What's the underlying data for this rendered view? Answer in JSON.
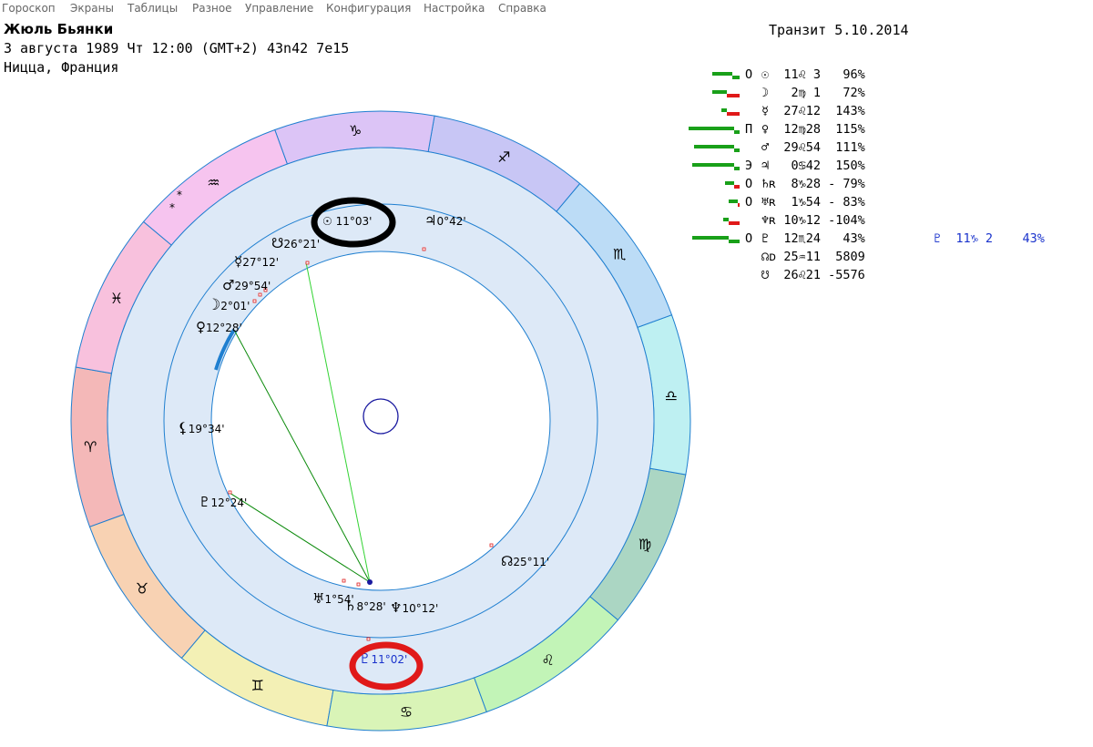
{
  "menu": [
    "Гороскоп",
    "Экраны",
    "Таблицы",
    "Разное",
    "Управление",
    "Конфигурация",
    "Настройка",
    "Справка"
  ],
  "person": {
    "name": "Жюль Бьянки",
    "birth_line": "3 августа 1989  Чт  12:00 (GMT+2) 43n42  7e15",
    "place": "Ницца, Франция"
  },
  "transit": "Транзит  5.10.2014",
  "planets": [
    {
      "mark": "O",
      "text": "☉  11♌ 3   96%",
      "bars": [
        {
          "color": "#19a019",
          "w": 22
        },
        {
          "color": "#19a019",
          "w": 8
        }
      ]
    },
    {
      "mark": "",
      "text": "☽   2♍ 1   72%",
      "bars": [
        {
          "color": "#19a019",
          "w": 16
        },
        {
          "color": "#e01919",
          "w": 14
        }
      ]
    },
    {
      "mark": "",
      "text": "☿  27♌12  143%",
      "bars": [
        {
          "color": "#19a019",
          "w": 6
        },
        {
          "color": "#e01919",
          "w": 14
        }
      ]
    },
    {
      "mark": "П",
      "text": "♀  12♍28  115%",
      "bars": [
        {
          "color": "#19a019",
          "w": 50
        },
        {
          "color": "#19a019",
          "w": 6
        }
      ]
    },
    {
      "mark": "",
      "text": "♂  29♌54  111%",
      "bars": [
        {
          "color": "#19a019",
          "w": 44
        },
        {
          "color": "#19a019",
          "w": 6
        }
      ]
    },
    {
      "mark": "Э",
      "text": "♃   0♋42  150%",
      "bars": [
        {
          "color": "#19a019",
          "w": 46
        },
        {
          "color": "#19a019",
          "w": 6
        }
      ]
    },
    {
      "mark": "O",
      "text": "♄ʀ  8♑28 - 79%",
      "bars": [
        {
          "color": "#19a019",
          "w": 10
        },
        {
          "color": "#e01919",
          "w": 6
        }
      ]
    },
    {
      "mark": "O",
      "text": "♅ʀ  1♑54 - 83%",
      "bars": [
        {
          "color": "#19a019",
          "w": 10
        },
        {
          "color": "#e01919",
          "w": 2
        }
      ]
    },
    {
      "mark": "",
      "text": "♆ʀ 10♑12 -104%",
      "bars": [
        {
          "color": "#19a019",
          "w": 6
        },
        {
          "color": "#e01919",
          "w": 12
        }
      ]
    },
    {
      "mark": "O",
      "text": "♇  12♏24   43%",
      "bars": [
        {
          "color": "#19a019",
          "w": 40
        },
        {
          "color": "#19a019",
          "w": 12
        }
      ],
      "extra": "♇  11♑ 2    43%"
    },
    {
      "mark": "",
      "text": "☊ᴅ 25♒11  5809",
      "bars": []
    },
    {
      "mark": "",
      "text": "☋  26♌21 -5576",
      "bars": []
    }
  ],
  "wheel": {
    "signs": [
      {
        "name": "aries-icon",
        "glyph": "♈",
        "color": "#f4b8b8"
      },
      {
        "name": "taurus-icon",
        "glyph": "♉",
        "color": "#f8d2b3"
      },
      {
        "name": "gemini-icon",
        "glyph": "♊",
        "color": "#f3f0b5"
      },
      {
        "name": "cancer-icon",
        "glyph": "♋",
        "color": "#d9f4b7"
      },
      {
        "name": "leo-icon",
        "glyph": "♌",
        "color": "#c2f4b7"
      },
      {
        "name": "virgo-icon",
        "glyph": "♍",
        "color": "#abd6c3"
      },
      {
        "name": "libra-icon",
        "glyph": "♎",
        "color": "#bef0f2"
      },
      {
        "name": "scorpio-icon",
        "glyph": "♏",
        "color": "#bcdcf6"
      },
      {
        "name": "sagittarius-icon",
        "glyph": "♐",
        "color": "#c8c6f5"
      },
      {
        "name": "capricorn-icon",
        "glyph": "♑",
        "color": "#dcc4f6"
      },
      {
        "name": "aquarius-icon",
        "glyph": "♒",
        "color": "#f6c4ef"
      },
      {
        "name": "pisces-icon",
        "glyph": "♓",
        "color": "#f8c1dd"
      }
    ],
    "planet_labels": [
      {
        "name": "sun-icon",
        "glyph": "☉",
        "text": "11°03'"
      },
      {
        "name": "jupiter-icon",
        "glyph": "♃",
        "text": "0°42'"
      },
      {
        "name": "north-node-icon",
        "glyph": "☋",
        "text": "26°21'"
      },
      {
        "name": "mercury-icon",
        "glyph": "☿",
        "text": "27°12'"
      },
      {
        "name": "mars-icon",
        "glyph": "♂",
        "text": "29°54'"
      },
      {
        "name": "moon-icon",
        "glyph": "☽",
        "text": "2°01'"
      },
      {
        "name": "venus-icon",
        "glyph": "♀",
        "text": "12°28'"
      },
      {
        "name": "lilith-icon",
        "glyph": "⚸",
        "text": "19°34'"
      },
      {
        "name": "pluto-icon",
        "glyph": "♇",
        "text": "12°24'"
      },
      {
        "name": "node-icon",
        "glyph": "☊",
        "text": "25°11'"
      },
      {
        "name": "uranus-icon",
        "glyph": "♅",
        "text": "1°54'"
      },
      {
        "name": "saturn-icon",
        "glyph": "♄",
        "text": "8°28'"
      },
      {
        "name": "neptune-icon",
        "glyph": "♆",
        "text": "10°12'"
      },
      {
        "name": "transit-pluto-icon",
        "glyph": "♇",
        "text": "11°02'"
      }
    ]
  }
}
